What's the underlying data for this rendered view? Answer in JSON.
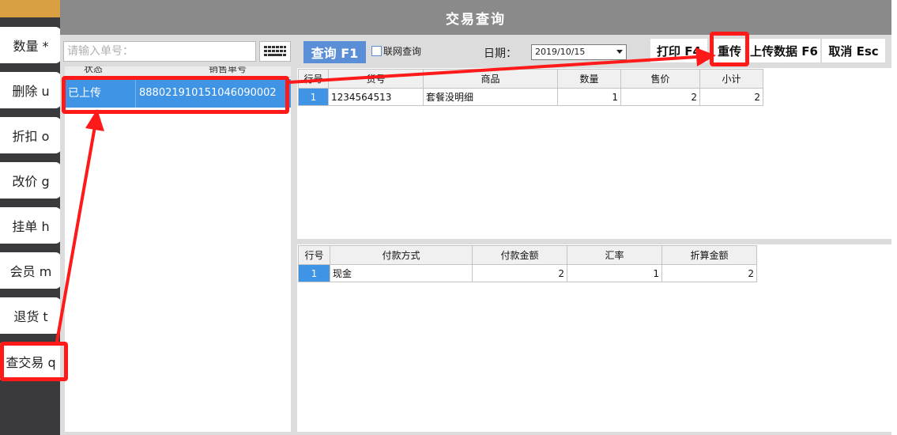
{
  "side_buttons": [
    {
      "label": "数量 *"
    },
    {
      "label": "删除 u"
    },
    {
      "label": "折扣 o"
    },
    {
      "label": "改价 g"
    },
    {
      "label": "挂单 h"
    },
    {
      "label": "会员 m"
    },
    {
      "label": "退货 t"
    },
    {
      "label": "查交易 q"
    }
  ],
  "dialog": {
    "title": "交易查询",
    "search_placeholder": "请输入单号：",
    "list": {
      "headers": [
        "状态",
        "销售单号"
      ],
      "selected_row": {
        "status": "已上传",
        "order_no": "888021910151046090002"
      }
    },
    "toolbar": {
      "query_button": "查询 F1",
      "online_query_label": "联网查询",
      "date_label": "日期：",
      "date_value": "2019/10/15",
      "print_button": "打印 F4",
      "reupload_button": "重传",
      "upload_data_button": "上传数据 F6",
      "cancel_button": "取消 Esc"
    },
    "goods_table": {
      "headers": [
        "行号",
        "货号",
        "商品",
        "数量",
        "售价",
        "小计"
      ],
      "rows": [
        {
          "row_no": "1",
          "sku": "1234564513",
          "product": "套餐没明细",
          "qty": "1",
          "price": "2",
          "subtotal": "2"
        }
      ]
    },
    "payment_table": {
      "headers": [
        "行号",
        "付款方式",
        "付款金额",
        "汇率",
        "折算金额"
      ],
      "rows": [
        {
          "row_no": "1",
          "method": "现金",
          "amount": "2",
          "rate": "1",
          "converted": "2"
        }
      ]
    }
  },
  "colors": {
    "accent_blue": "#3f94e6",
    "query_button": "#5a8fd8",
    "highlight_red": "#ff1a1a",
    "titlebar": "#8a8a8a"
  }
}
